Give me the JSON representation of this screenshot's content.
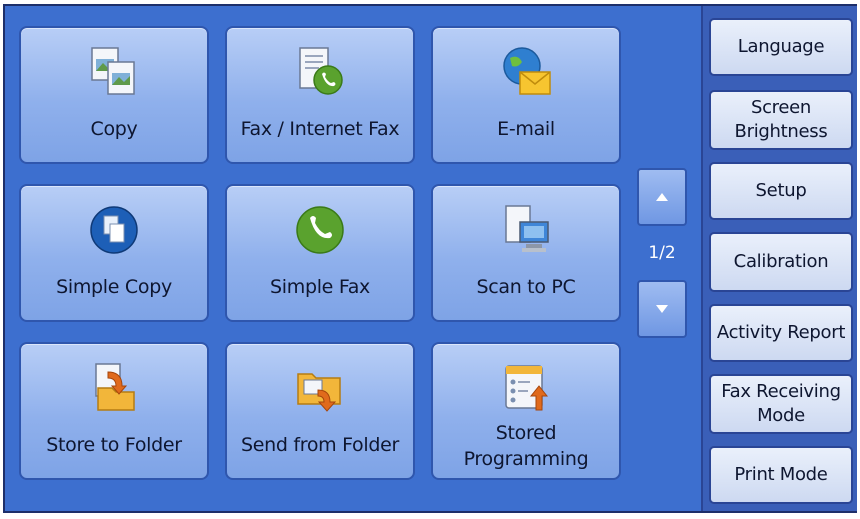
{
  "tiles": [
    {
      "id": "copy",
      "label": "Copy",
      "icon": "copy-icon"
    },
    {
      "id": "fax",
      "label": "Fax / Internet Fax",
      "icon": "fax-icon"
    },
    {
      "id": "email",
      "label": "E-mail",
      "icon": "email-icon"
    },
    {
      "id": "simple-copy",
      "label": "Simple Copy",
      "icon": "simple-copy-icon"
    },
    {
      "id": "simple-fax",
      "label": "Simple Fax",
      "icon": "phone-icon"
    },
    {
      "id": "scan-pc",
      "label": "Scan to PC",
      "icon": "computer-icon"
    },
    {
      "id": "store-folder",
      "label": "Store to Folder",
      "icon": "store-folder-icon"
    },
    {
      "id": "send-folder",
      "label": "Send from Folder",
      "icon": "send-folder-icon"
    },
    {
      "id": "stored-prog",
      "label_line1": "Stored",
      "label_line2": "Programming",
      "icon": "stored-programming-icon"
    }
  ],
  "pagination": {
    "indicator": "1/2",
    "up_icon": "arrow-up-icon",
    "down_icon": "arrow-down-icon"
  },
  "side_buttons": [
    {
      "line1": "Language"
    },
    {
      "line1": "Screen",
      "line2": "Brightness"
    },
    {
      "line1": "Setup"
    },
    {
      "line1": "Calibration"
    },
    {
      "line1": "Activity Report"
    },
    {
      "line1": "Fax Receiving",
      "line2": "Mode"
    },
    {
      "line1": "Print Mode"
    }
  ],
  "colors": {
    "background": "#3d6fcf",
    "tile": "#8fb0ec",
    "side_button": "#dce5f6"
  }
}
